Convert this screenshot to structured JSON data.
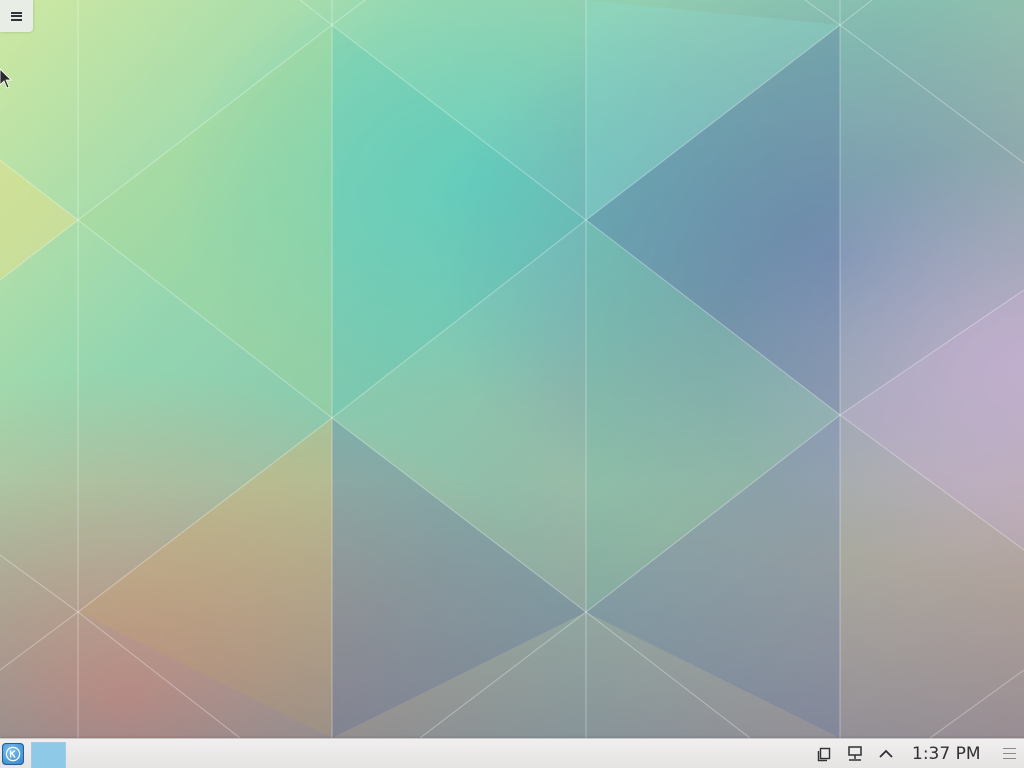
{
  "desktop": {
    "wallpaper_name": "kde-geometric-wallpaper",
    "colors": {
      "teal": "#7fd6cf",
      "lime": "#b7d98e",
      "orange": "#e9ab6c",
      "blue": "#7f9fc9",
      "lavender": "#b3aed0",
      "panel_bg": "#ebe8e8",
      "pager_active": "#8ec9e8"
    }
  },
  "toolbox": {
    "icon": "hamburger-menu-icon"
  },
  "taskbar": {
    "launcher_icon": "kde-logo-icon",
    "pager_icon": "virtual-desktop-pager",
    "tray": {
      "icons": [
        "clipboard-icon",
        "network-icon",
        "chevron-up-icon"
      ]
    },
    "clock": "1:37 PM",
    "config_icon": "panel-config-icon"
  }
}
